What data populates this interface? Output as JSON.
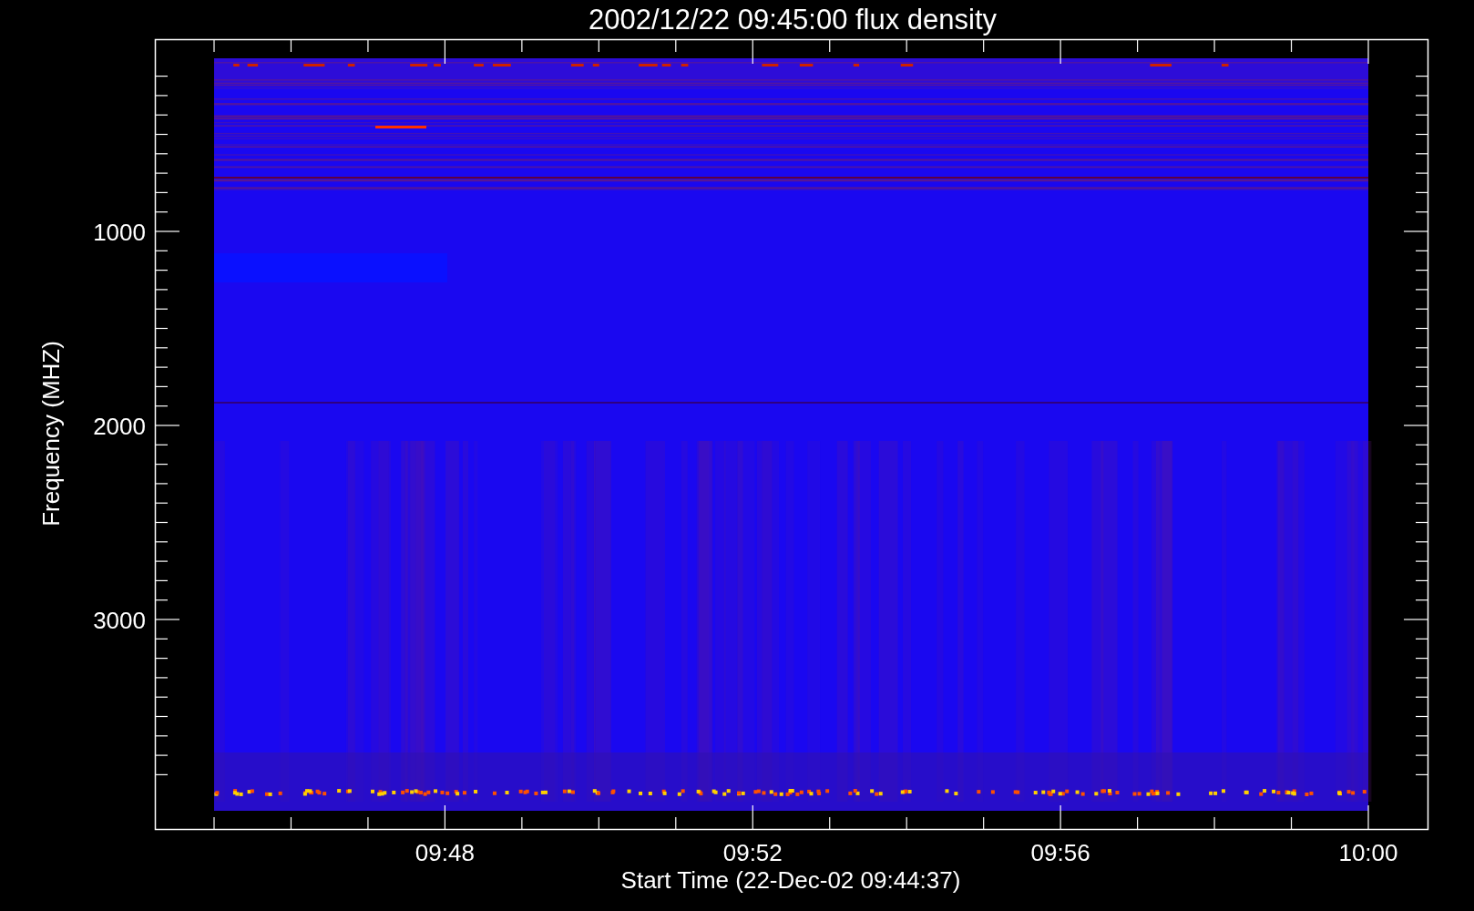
{
  "title": "2002/12/22 09:45:00 flux density",
  "xlabel": "Start Time (22-Dec-02 09:44:37)",
  "ylabel": "Frequency (MHZ)",
  "xticks": [
    "09:48",
    "09:52",
    "09:56",
    "10:00"
  ],
  "yticks": [
    "1000",
    "2000",
    "3000"
  ]
}
